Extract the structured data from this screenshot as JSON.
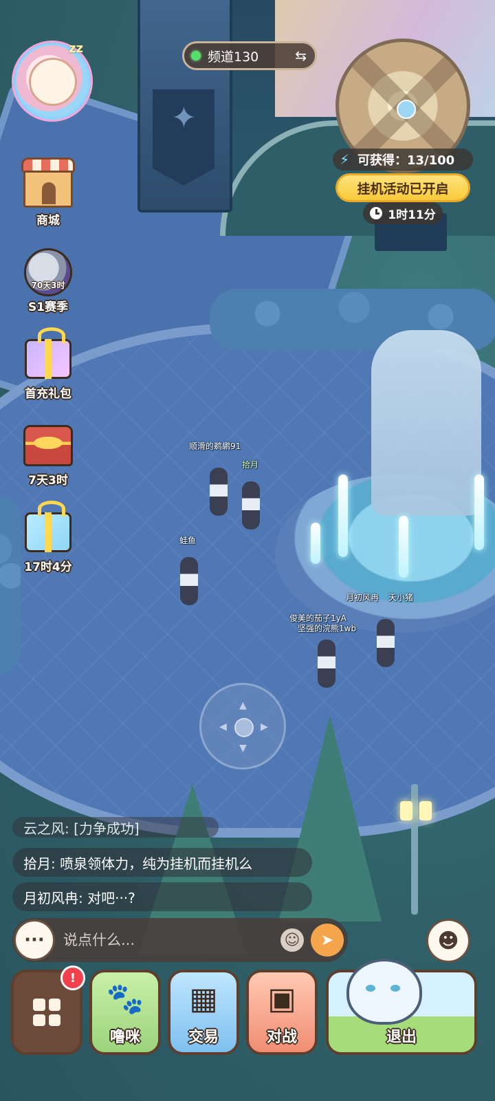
{
  "hud": {
    "channel_label": "频道130",
    "obtain_label": "可获得：13/100",
    "idle_activity_label": "挂机活动已开启",
    "timer_label": "1时11分"
  },
  "side_menu": {
    "shop_label": "商城",
    "season_sub": "70天3时",
    "season_label": "S1赛季",
    "first_pack_label": "首充礼包",
    "chest_label": "7天3时",
    "gift_label": "17时4分"
  },
  "players": {
    "p1": "顺滑的鹈鹕91",
    "p2": "拾月",
    "p3": "蛙鱼",
    "p4": "月初风冉",
    "p5": "天小猪",
    "p6": "俊美的茄子1yA",
    "p7": "坚强的浣熊1wb"
  },
  "chat": {
    "partial_line": "云之风: [力争成功]",
    "messages": [
      "拾月: 喷泉领体力，纯为挂机而挂机么",
      "月初风冉: 对吧···?"
    ],
    "input_placeholder": "说点什么..."
  },
  "bottom_bar": {
    "menu_badge": "!",
    "pet_label": "噜咪",
    "trade_label": "交易",
    "battle_label": "对战",
    "exit_label": "退出"
  },
  "icons": {
    "channel_status": "online-dot-icon",
    "channel_swap": "swap-arrows-icon",
    "energy": "lightning-bolt-icon",
    "timer": "clock-icon",
    "chat_more": "ellipsis-icon",
    "emoji": "smiley-icon",
    "send": "paper-plane-icon",
    "emote": "emote-wave-icon"
  },
  "colors": {
    "idle_badge": "#f8c93a",
    "energy": "#7ce6ff",
    "online": "#56e06a",
    "notification": "#f2404c",
    "send_button": "#f5a64d"
  }
}
